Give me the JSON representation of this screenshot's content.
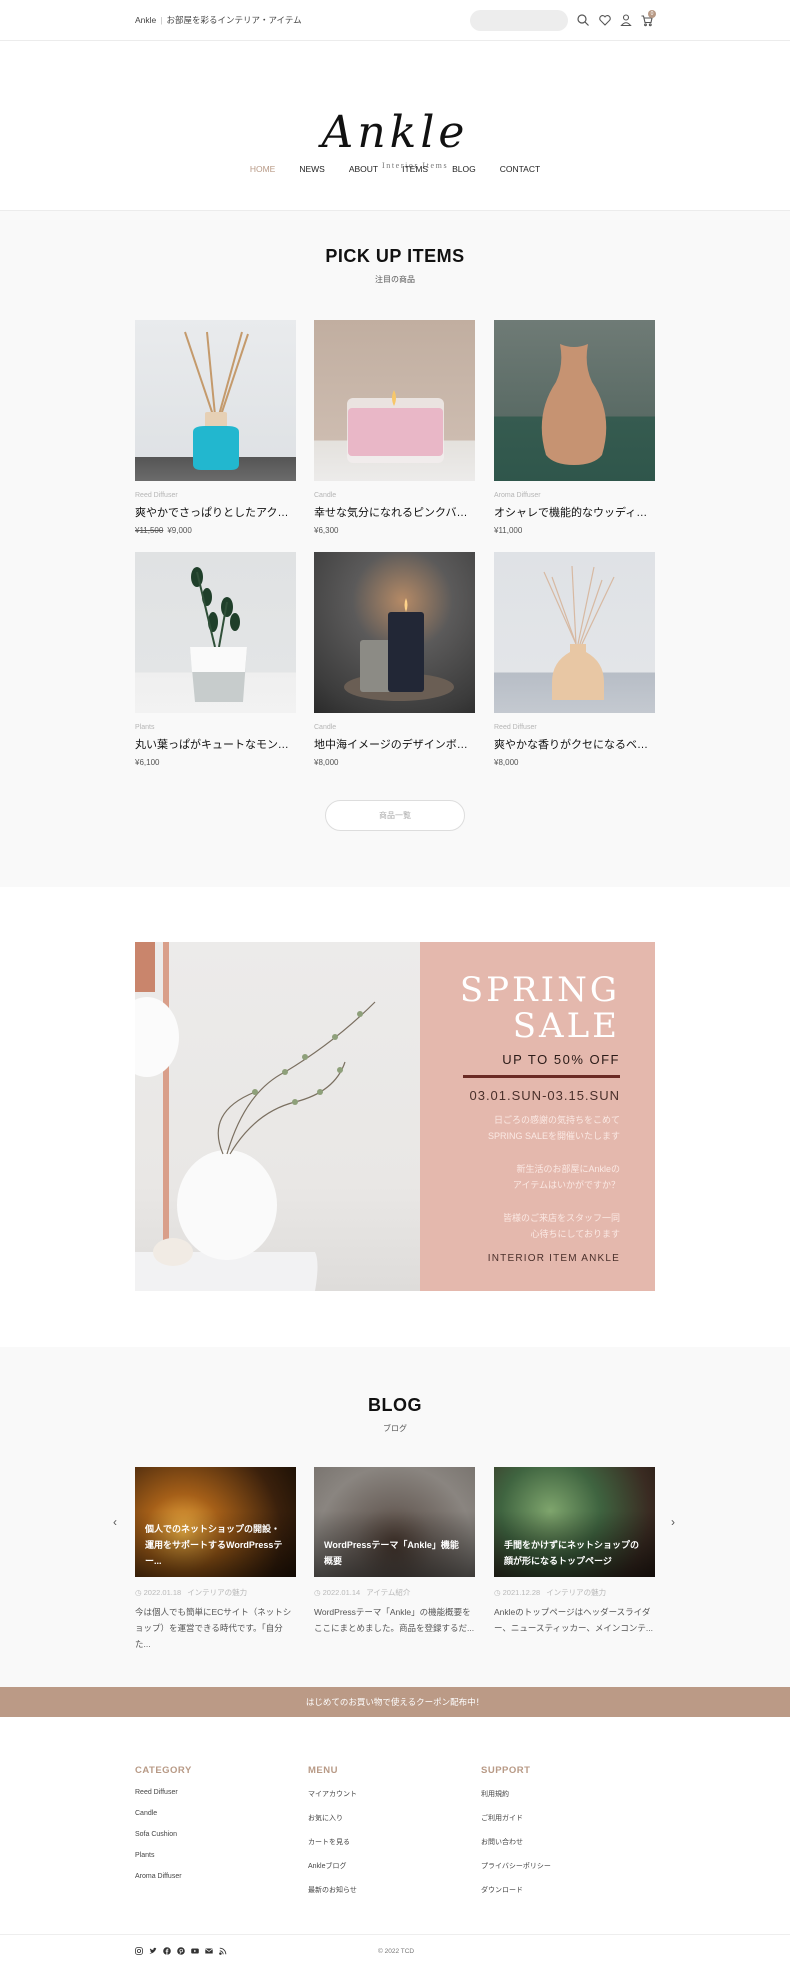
{
  "topbar": {
    "brand": "Ankle",
    "separator": "|",
    "tagline": "お部屋を彩るインテリア・アイテム",
    "search_placeholder": "",
    "icons": [
      "search-icon",
      "heart-icon",
      "user-icon",
      "cart-icon"
    ],
    "cart_count": "0"
  },
  "header": {
    "logo_text": "Ankle",
    "logo_sub": "Interior Items",
    "nav": [
      {
        "label": "HOME",
        "active": true
      },
      {
        "label": "NEWS"
      },
      {
        "label": "ABOUT"
      },
      {
        "label": "ITEMS"
      },
      {
        "label": "BLOG"
      },
      {
        "label": "CONTACT"
      }
    ]
  },
  "pickup": {
    "title": "PICK UP ITEMS",
    "subtitle": "注目の商品",
    "items": [
      {
        "category": "Reed Diffuser",
        "name": "爽やかでさっぱりとしたアクアマリンの香り",
        "old_price": "¥11,500",
        "price": "¥9,000"
      },
      {
        "category": "Candle",
        "name": "幸せな気分になれるピンクバニラ",
        "old_price": "",
        "price": "¥6,300"
      },
      {
        "category": "Aroma Diffuser",
        "name": "オシャレで機能的なウッディーアロマディフューザー",
        "old_price": "",
        "price": "¥11,000"
      },
      {
        "category": "Plants",
        "name": "丸い葉っぱがキュートなモンステラ",
        "old_price": "",
        "price": "¥6,100"
      },
      {
        "category": "Candle",
        "name": "地中海イメージのデザインボタニカルキャンドル",
        "old_price": "",
        "price": "¥8,000"
      },
      {
        "category": "Reed Diffuser",
        "name": "爽やかな香りがクセになるベルガモット",
        "old_price": "",
        "price": "¥8,000"
      }
    ],
    "more_button": "商品一覧"
  },
  "banner": {
    "title_line1": "SPRING",
    "title_line2": "SALE",
    "discount": "UP TO 50% OFF",
    "dates": "03.01.SUN-03.15.SUN",
    "msg1_line1": "日ごろの感謝の気持ちをこめて",
    "msg1_line2": "SPRING SALEを開催いたします",
    "msg2_line1": "新生活のお部屋にAnkleの",
    "msg2_line2": "アイテムはいかがですか？",
    "msg3_line1": "皆様のご来店をスタッフ一同",
    "msg3_line2": "心待ちにしております",
    "footer": "INTERIOR ITEM ANKLE",
    "accent": "#e4b8ad"
  },
  "blog": {
    "title": "BLOG",
    "subtitle": "ブログ",
    "posts": [
      {
        "title": "個人でのネットショップの開設・運用をサポートするWordPressテー...",
        "date": "2022.01.18",
        "category": "インテリアの魅力",
        "excerpt": "今は個人でも簡単にECサイト（ネットショップ）を運営できる時代です。「自分た..."
      },
      {
        "title": "WordPressテーマ「Ankle」機能概要",
        "date": "2022.01.14",
        "category": "アイテム紹介",
        "excerpt": "WordPressテーマ「Ankle」の機能概要をここにまとめました。商品を登録するだ..."
      },
      {
        "title": "手間をかけずにネットショップの顔が形になるトップページ",
        "date": "2021.12.28",
        "category": "インテリアの魅力",
        "excerpt": "Ankleのトップページはヘッダースライダー、ニュースティッカー、メインコンテ..."
      }
    ],
    "prev": "‹",
    "next": "›"
  },
  "coupon": {
    "text": "はじめてのお買い物で使えるクーポン配布中！",
    "color": "#bb9a86"
  },
  "footer": {
    "columns": [
      {
        "heading": "CATEGORY",
        "links": [
          "Reed Diffuser",
          "Candle",
          "Sofa Cushion",
          "Plants",
          "Aroma Diffuser"
        ]
      },
      {
        "heading": "MENU",
        "links": [
          "マイアカウント",
          "お気に入り",
          "カートを見る",
          "Ankleブログ",
          "最新のお知らせ"
        ]
      },
      {
        "heading": "SUPPORT",
        "links": [
          "利用規約",
          "ご利用ガイド",
          "お問い合わせ",
          "プライバシーポリシー",
          "ダウンロード"
        ]
      }
    ],
    "social": [
      "instagram-icon",
      "twitter-icon",
      "facebook-icon",
      "pinterest-icon",
      "youtube-icon",
      "mail-icon",
      "rss-icon"
    ],
    "copyright": "© 2022 TCD",
    "accent": "#b89a86"
  }
}
